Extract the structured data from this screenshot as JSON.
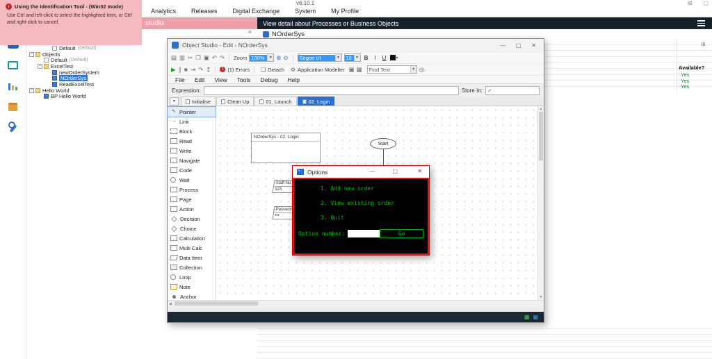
{
  "top_bar": {
    "version": "v6.10.1",
    "nav_tabs": [
      "Analytics",
      "Releases",
      "Digital Exchange",
      "System",
      "My Profile"
    ],
    "studio_label": "studio",
    "detail_header": "View detail about Processes or Business Objects",
    "object_name": "NOrderSys"
  },
  "identification_tooltip": {
    "title": "Using the Identification Tool - (Win32 mode)",
    "body": "Use Ctrl and left-click to select the highlighted item, or Ctrl and right-click to cancel."
  },
  "sidebar": {
    "icons": [
      "studio-icon",
      "control-icon",
      "analytics-icon",
      "releases-icon",
      "tools-icon"
    ]
  },
  "tree": {
    "items": [
      {
        "label": "Default",
        "suffix": "(Default)",
        "depth": 2,
        "icon": "sheet"
      },
      {
        "label": "Objects",
        "suffix": "",
        "depth": 0,
        "expander": true,
        "icon": "folder"
      },
      {
        "label": "Default",
        "suffix": "(Default)",
        "depth": 1,
        "icon": "sheet"
      },
      {
        "label": "ExcelTest",
        "suffix": "",
        "depth": 1,
        "expander": true,
        "icon": "folder"
      },
      {
        "label": "newOrderSystem",
        "suffix": "",
        "depth": 2,
        "icon": "object"
      },
      {
        "label": "NOrderSys",
        "suffix": "",
        "depth": 2,
        "icon": "object",
        "selected": true
      },
      {
        "label": "ReadExcelTest",
        "suffix": "",
        "depth": 2,
        "icon": "object"
      },
      {
        "label": "Hello World",
        "suffix": "",
        "depth": 0,
        "expander": true,
        "icon": "folder"
      },
      {
        "label": "BP Hello World",
        "suffix": "",
        "depth": 1,
        "icon": "object"
      }
    ]
  },
  "object_studio": {
    "window_title": "Object Studio - Edit - NOrderSys",
    "menu": [
      "File",
      "Edit",
      "View",
      "Tools",
      "Debug",
      "Help"
    ],
    "toolbar1_icons": [
      "save-icon",
      "print-icon",
      "cut-icon",
      "copy-icon",
      "paste-icon",
      "undo-icon",
      "redo-icon"
    ],
    "toolbar2_icons": [
      "play-icon",
      "pause-icon",
      "stop-icon",
      "step-in-icon",
      "step-over-icon",
      "step-out-icon"
    ],
    "toolbar": {
      "zoom_label": "Zoom",
      "zoom_value": "100%",
      "font_name": "Segoe UI",
      "font_size": "10",
      "bold": "B",
      "italic": "I",
      "underline": "U",
      "errors_label": "(1) Errors",
      "detach_label": "Detach",
      "app_modeller_label": "Application Modeller",
      "find_text_value": "Find Text"
    },
    "expression_label": "Expression:",
    "store_in_label": "Store In:",
    "page_tabs": [
      {
        "label": "Initialise"
      },
      {
        "label": "Clean Up"
      },
      {
        "label": "01. Launch"
      },
      {
        "label": "02. Login",
        "selected": true
      }
    ],
    "tools": [
      {
        "label": "Pointer",
        "icon": "cursor",
        "selected": true
      },
      {
        "label": "Link",
        "icon": "link"
      },
      {
        "label": "Block",
        "icon": "dashed-rect"
      },
      {
        "label": "Read",
        "icon": "rect"
      },
      {
        "label": "Write",
        "icon": "rect"
      },
      {
        "label": "Navigate",
        "icon": "rect"
      },
      {
        "label": "Code",
        "icon": "rect"
      },
      {
        "label": "Wait",
        "icon": "circle"
      },
      {
        "label": "Process",
        "icon": "rect"
      },
      {
        "label": "Page",
        "icon": "rect"
      },
      {
        "label": "Action",
        "icon": "rect"
      },
      {
        "label": "Decision",
        "icon": "diamond"
      },
      {
        "label": "Choice",
        "icon": "diamond"
      },
      {
        "label": "Calculation",
        "icon": "rect"
      },
      {
        "label": "Multi Calc",
        "icon": "rect"
      },
      {
        "label": "Data Item",
        "icon": "para"
      },
      {
        "label": "Collection",
        "icon": "grid"
      },
      {
        "label": "Loop",
        "icon": "circle"
      },
      {
        "label": "Note",
        "icon": "note"
      },
      {
        "label": "Anchor",
        "icon": "dot"
      }
    ],
    "canvas": {
      "flow_title": "NOrderSys - 02. Login",
      "start_label": "Start",
      "data_items": [
        {
          "name": "Staff Nu",
          "value": "123"
        },
        {
          "name": "Passwor",
          "value": "•••"
        }
      ]
    }
  },
  "options_console": {
    "title": "Options",
    "lines": [
      "1. Add new order",
      "2. View existing order",
      "3. Quit"
    ],
    "prompt": "Option number:",
    "input_value": "",
    "go_label": "Go"
  },
  "detail_table": {
    "column_header": "Available?",
    "rows": [
      "Yes",
      "Yes",
      "Yes"
    ]
  },
  "colors": {
    "accent_blue": "#2d6fd0",
    "header_navy": "#16212e",
    "tooltip_pink": "#f5bac0",
    "console_green": "#00c400",
    "console_border_red": "#dd1111",
    "available_green": "#1e7d32"
  }
}
